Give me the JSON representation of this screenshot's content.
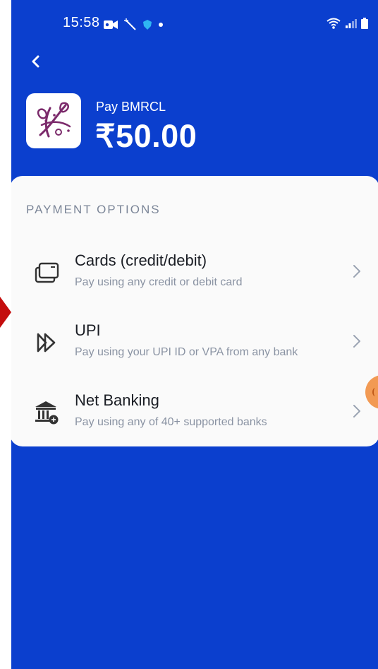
{
  "status_bar": {
    "time": "15:58"
  },
  "header": {
    "back_icon": "chevron-left-icon",
    "merchant_logo": "bmrcl-logo",
    "pay_to": "Pay BMRCL",
    "amount": "₹50.00"
  },
  "payment_options": {
    "title": "PAYMENT OPTIONS",
    "items": [
      {
        "title": "Cards (credit/debit)",
        "subtitle": "Pay using any credit or debit card",
        "icon": "card-icon"
      },
      {
        "title": "UPI",
        "subtitle": "Pay using your UPI ID or VPA from any bank",
        "icon": "upi-icon"
      },
      {
        "title": "Net Banking",
        "subtitle": "Pay using any of 40+ supported banks",
        "icon": "bank-icon"
      }
    ]
  },
  "colors": {
    "brand_blue": "#0b3fce",
    "sheet_bg": "#fafafa",
    "muted_text": "#8a93a3",
    "logo_purple": "#7b2a6b",
    "marker_red": "#c40d0d"
  }
}
